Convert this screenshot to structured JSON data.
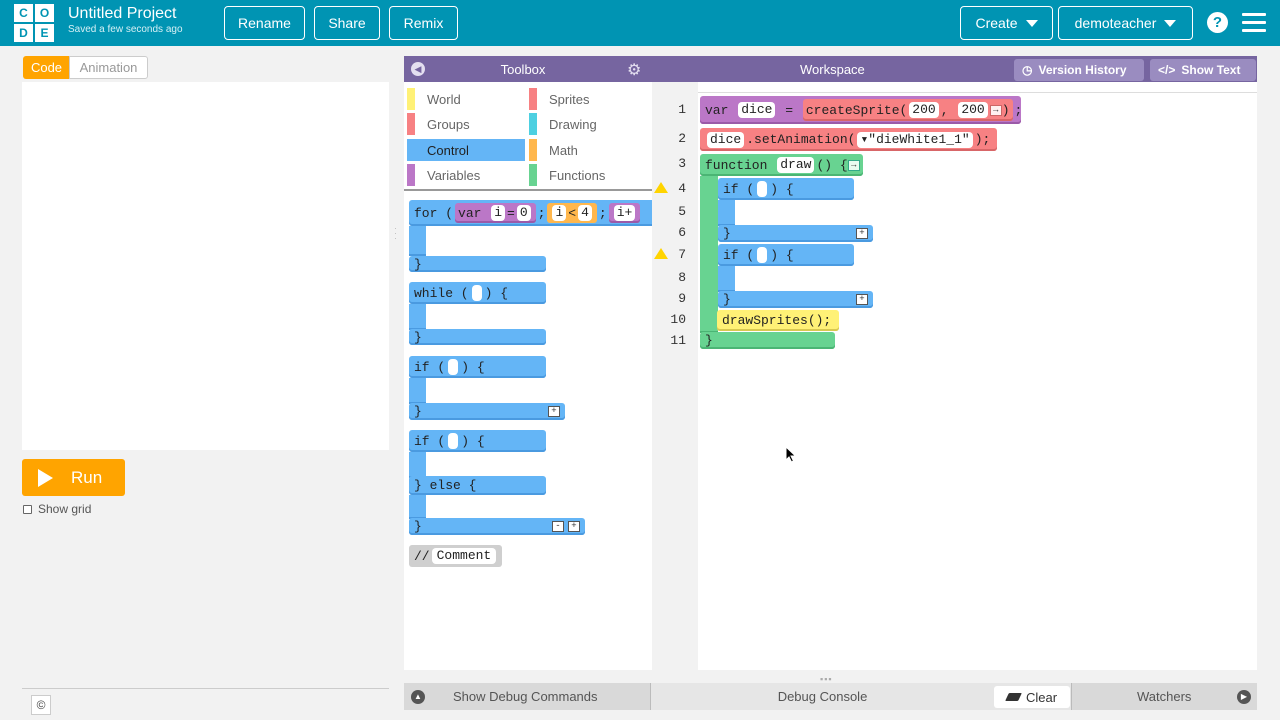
{
  "header": {
    "logo_letters": [
      "C",
      "O",
      "D",
      "E"
    ],
    "project_title": "Untitled Project",
    "saved_status": "Saved a few seconds ago",
    "buttons": {
      "rename": "Rename",
      "share": "Share",
      "remix": "Remix",
      "create": "Create",
      "user": "demoteacher"
    },
    "help_glyph": "?"
  },
  "left": {
    "tabs": {
      "code": "Code",
      "animation": "Animation"
    },
    "run_label": "Run",
    "show_grid_label": "Show grid",
    "copyright_glyph": "©"
  },
  "toolbox": {
    "title": "Toolbox",
    "categories": [
      {
        "label": "World",
        "color": "#fff176"
      },
      {
        "label": "Sprites",
        "color": "#f78183"
      },
      {
        "label": "Groups",
        "color": "#f78183"
      },
      {
        "label": "Drawing",
        "color": "#4dd0e1"
      },
      {
        "label": "Control",
        "color": "#64b5f6"
      },
      {
        "label": "Math",
        "color": "#ffb74d"
      },
      {
        "label": "Variables",
        "color": "#bb77c7"
      },
      {
        "label": "Functions",
        "color": "#68d391"
      }
    ],
    "blocks": {
      "for": {
        "kw": "for (",
        "var": "var",
        "i": "i",
        "eq": "=",
        "zero": "0",
        "semi": ";",
        "i2": "i",
        "lt": "<",
        "four": "4",
        "semi2": ";",
        "inc": "i+",
        "close": "}"
      },
      "while": {
        "kw": "while (",
        "tail": ") {",
        "close": "}"
      },
      "if1": {
        "kw": "if (",
        "tail": ") {",
        "close": "}",
        "plus": "+"
      },
      "ifelse": {
        "kw": "if (",
        "tail": ") {",
        "else": "} else {",
        "close": "}",
        "minus": "-",
        "plus": "+"
      },
      "comment": {
        "kw": "//",
        "text": "Comment"
      }
    }
  },
  "workspace": {
    "title": "Workspace",
    "version_history": "Version History",
    "show_text": "Show Text",
    "line_numbers": [
      "1",
      "2",
      "3",
      "4",
      "5",
      "6",
      "7",
      "8",
      "9",
      "10",
      "11"
    ],
    "code": {
      "l1": {
        "kw": "var",
        "name": "dice",
        "eq": "=",
        "fn": "createSprite(",
        "x": "200",
        "comma": ",",
        "y": "200",
        "close": ")",
        "semi": ";"
      },
      "l2": {
        "obj": "dice",
        "method": ".setAnimation(",
        "value": "\"dieWhite1_1\"",
        "close": ");"
      },
      "l3": {
        "kw": "function",
        "name": "draw",
        "tail": "() {"
      },
      "if": {
        "kw": "if (",
        "tail": ") {",
        "close": "}",
        "plus": "+"
      },
      "draw_sprites": "drawSprites();",
      "fn_close": "}"
    }
  },
  "bottom": {
    "show_debug": "Show Debug Commands",
    "debug_console": "Debug Console",
    "clear": "Clear",
    "watchers": "Watchers"
  },
  "colors": {
    "header": "#0094b3",
    "panel_header": "#7665a0",
    "control": "#64b5f6",
    "run": "#ffa400",
    "code_tab": "#ffa400"
  }
}
